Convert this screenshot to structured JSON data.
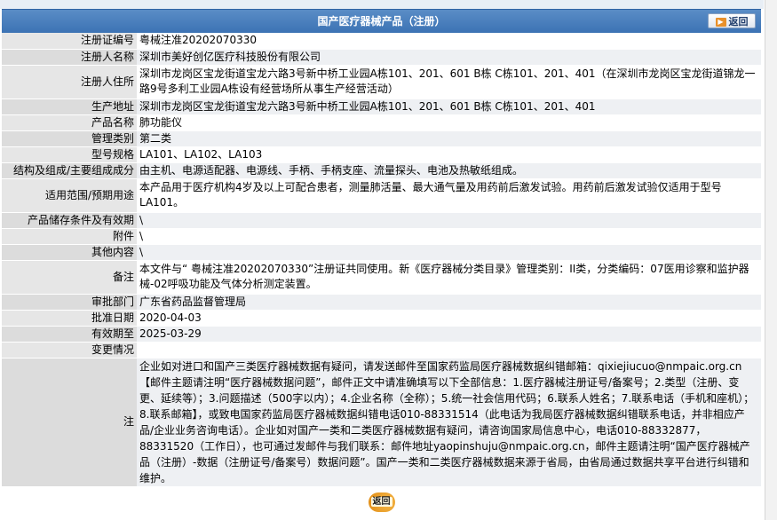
{
  "header": {
    "title": "国产医疗器械产品（注册）",
    "back_label": "返回"
  },
  "rows": [
    {
      "label": "注册证编号",
      "value": "粤械注准20202070330"
    },
    {
      "label": "注册人名称",
      "value": "深圳市美好创亿医疗科技股份有限公司"
    },
    {
      "label": "注册人住所",
      "value": "深圳市龙岗区宝龙街道宝龙六路3号新中桥工业园A栋101、201、601 B栋 C栋101、201、401（在深圳市龙岗区宝龙街道锦龙一路9号多利工业园A栋设有经营场所从事生产经营活动）"
    },
    {
      "label": "生产地址",
      "value": "深圳市龙岗区宝龙街道宝龙六路3号新中桥工业园A栋101、201、601 B栋 C栋101、201、401"
    },
    {
      "label": "产品名称",
      "value": "肺功能仪"
    },
    {
      "label": "管理类别",
      "value": "第二类"
    },
    {
      "label": "型号规格",
      "value": "LA101、LA102、LA103"
    },
    {
      "label": "结构及组成/主要组成成分",
      "value": "由主机、电源适配器、电源线、手柄、手柄支座、流量探头、电池及热敏纸组成。"
    },
    {
      "label": "适用范围/预期用途",
      "value": "本产品用于医疗机构4岁及以上可配合患者，测量肺活量、最大通气量及用药前后激发试验。用药前后激发试验仅适用于型号LA101。"
    },
    {
      "label": "产品储存条件及有效期",
      "value": "\\"
    },
    {
      "label": "附件",
      "value": "\\"
    },
    {
      "label": "其他内容",
      "value": "\\"
    },
    {
      "label": "备注",
      "value": "本文件与“ 粤械注准20202070330”注册证共同使用。新《医疗器械分类目录》管理类别：II类，分类编码：07医用诊察和监护器械-02呼吸功能及气体分析测定装置。"
    },
    {
      "label": "审批部门",
      "value": "广东省药品监督管理局"
    },
    {
      "label": "批准日期",
      "value": "2020-04-03"
    },
    {
      "label": "有效期至",
      "value": "2025-03-29"
    },
    {
      "label": "变更情况",
      "value": ""
    },
    {
      "label": "注",
      "value": "企业如对进口和国产三类医疗器械数据有疑问，请发送邮件至国家药监局医疗器械数据纠错邮箱：qixiejiucuo@nmpaic.org.cn【邮件主题请注明“医疗器械数据问题”，邮件正文中请准确填写以下全部信息：1.医疗器械注册证号/备案号；2.类型（注册、变更、延续等）；3.问题描述（500字以内）；4.企业名称（全称）；5.统一社会信用代码；6.联系人姓名；7.联系电话（手机和座机）；8.联系邮箱】，或致电国家药监局医疗器械数据纠错电话010-88331514（此电话为我局医疗器械数据纠错联系电话，并非相应产品/企业业务咨询电话）。企业如对国产一类和二类医疗器械数据有疑问，请咨询国家局信息中心，电话010-88332877，88331520（工作日），也可通过发邮件与我们联系：邮件地址yaopinshuju@nmpaic.org.cn，邮件主题请注明“国产医疗器械产品（注册）-数据（注册证号/备案号）数据问题”。国产一类和二类医疗器械数据来源于省局，由省局通过数据共享平台进行纠错和维护。"
    }
  ],
  "footer": {
    "back_label": "返回"
  }
}
